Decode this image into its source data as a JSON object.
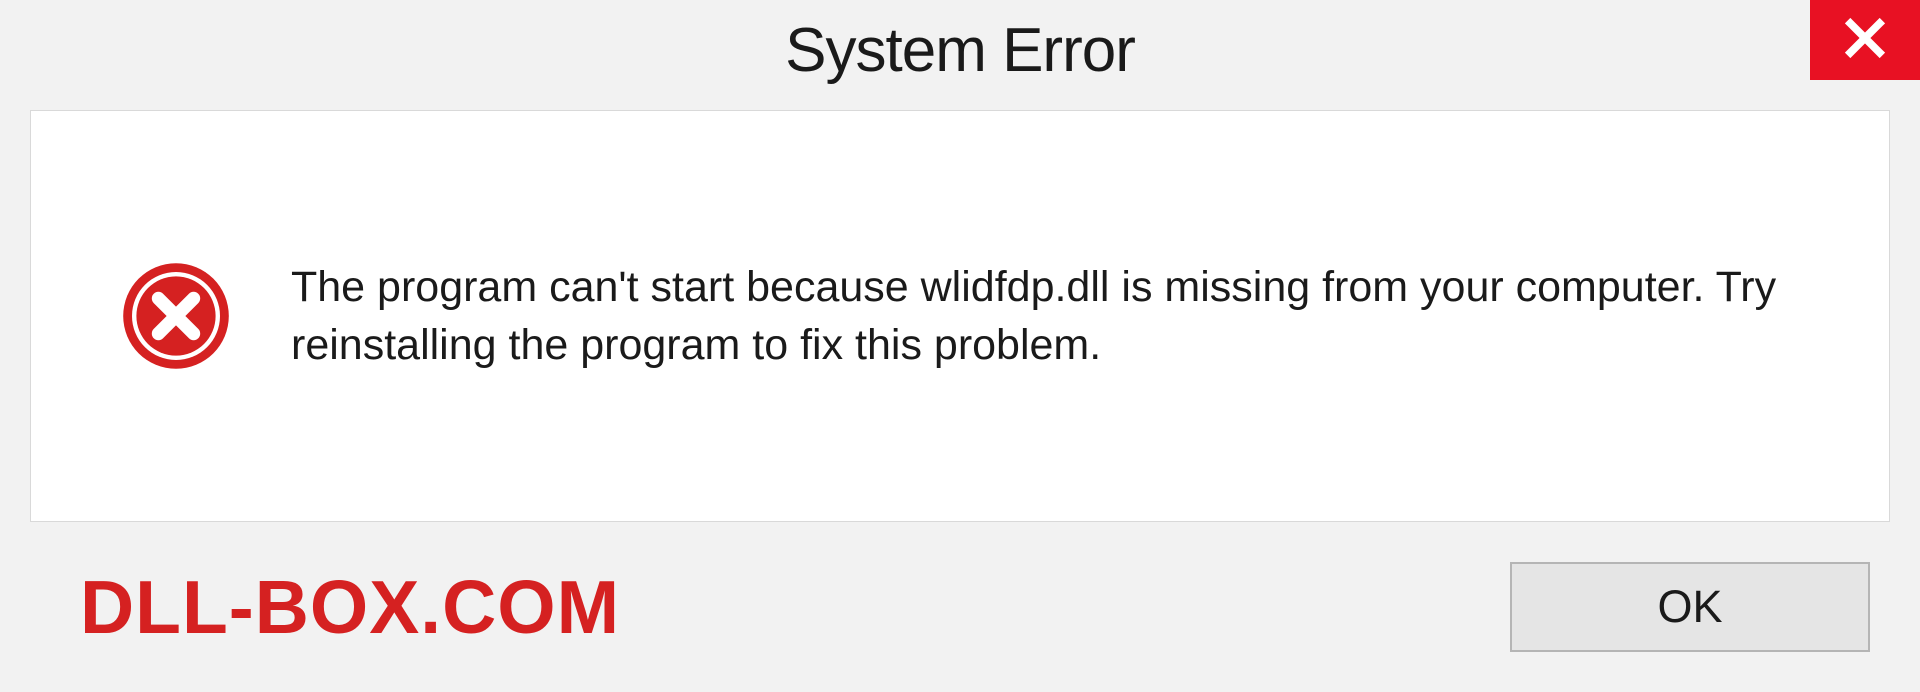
{
  "titlebar": {
    "title": "System Error"
  },
  "content": {
    "message": "The program can't start because wlidfdp.dll is missing from your computer. Try reinstalling the program to fix this problem."
  },
  "footer": {
    "watermark": "DLL-BOX.COM",
    "ok_label": "OK"
  },
  "colors": {
    "accent_red": "#e81123",
    "text_red": "#d52121"
  }
}
